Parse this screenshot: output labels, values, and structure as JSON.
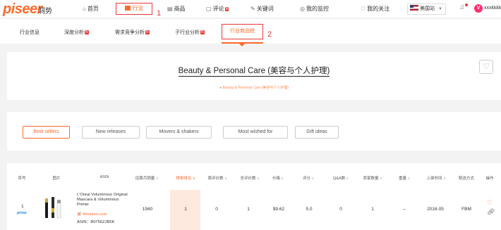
{
  "brand": {
    "logo": "piseer",
    "name": "洞势"
  },
  "topnav": {
    "items": [
      {
        "label": "首页",
        "icon": "home-icon",
        "glyph": "⌂"
      },
      {
        "label": "行业",
        "icon": "grid-icon",
        "active": true
      },
      {
        "label": "商品",
        "icon": "box-icon",
        "glyph": "▤"
      },
      {
        "label": "评论",
        "icon": "comment-icon",
        "glyph": "▢",
        "badge": "N"
      },
      {
        "label": "关键词",
        "icon": "keyword-icon",
        "glyph": "✎"
      },
      {
        "label": "我的监控",
        "icon": "monitor-icon",
        "glyph": "◎"
      },
      {
        "label": "我的关注",
        "icon": "heart-icon",
        "glyph": "♡"
      }
    ],
    "region": "美国站",
    "user": "xxxkkkk"
  },
  "annotations": {
    "one": "1",
    "two": "2"
  },
  "subnav": {
    "items": [
      {
        "label": "行业信息"
      },
      {
        "label": "深度分析",
        "badge": "N"
      },
      {
        "label": "需求竞争分析",
        "badge": "N"
      },
      {
        "label": "子行业分析",
        "badge": "N"
      },
      {
        "label": "行业商品榜",
        "active": true
      }
    ]
  },
  "hero": {
    "title": "Beauty & Personal Care (美容与个人护理)",
    "crumb": "● Beauty & Personal Care (美容与个人护理)"
  },
  "filters": [
    "Best sellers",
    "New releases",
    "Movers & shakers",
    "Most wished for",
    "Gift ideas"
  ],
  "table": {
    "headers": [
      "序号",
      "图片",
      "ASIN",
      "估算月销量",
      "榜单排名",
      "周评价数",
      "总评价数",
      "价格",
      "评分",
      "Q&A数",
      "卖家数量",
      "重量",
      "上架时间",
      "配送方式",
      "操作"
    ],
    "rows": [
      {
        "index": "1",
        "prime": "prime",
        "title": "L'Oreal Voluminous Original Mascara & Voluminous Primer",
        "store": "Amazon.com",
        "asin": "ASIN：B0756ZJB5K",
        "monthly_sales": "1940",
        "rank": "1",
        "weekly_reviews": "0",
        "total_reviews": "1",
        "price": "$9.62",
        "rating": "5.0",
        "qa": "0",
        "sellers": "1",
        "weight": "--",
        "listed": "2016-05",
        "fulfillment": "FBM"
      }
    ]
  },
  "colors": {
    "accent": "#ff6a2b",
    "highlight": "#e53935",
    "rank_bg": "#fde9dd"
  }
}
